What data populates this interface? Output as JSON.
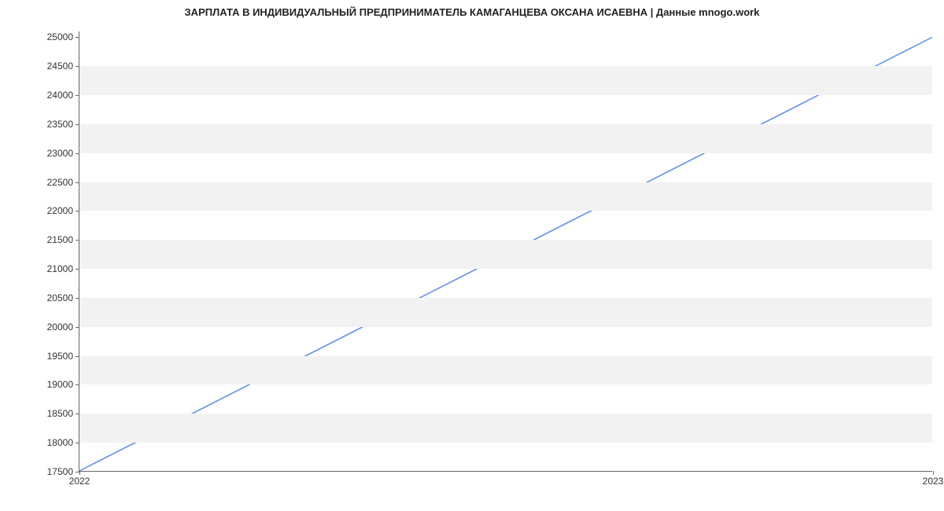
{
  "chart_data": {
    "type": "line",
    "title": "ЗАРПЛАТА В ИНДИВИДУАЛЬНЫЙ ПРЕДПРИНИМАТЕЛЬ КАМАГАНЦЕВА ОКСАНА ИСАЕВНА | Данные mnogo.work",
    "xlabel": "",
    "ylabel": "",
    "x": [
      "2022",
      "2023"
    ],
    "values": [
      17500,
      25000
    ],
    "y_ticks": [
      17500,
      18000,
      18500,
      19000,
      19500,
      20000,
      20500,
      21000,
      21500,
      22000,
      22500,
      23000,
      23500,
      24000,
      24500,
      25000
    ],
    "x_ticks": [
      "2022",
      "2023"
    ],
    "ylim": [
      17500,
      25100
    ],
    "line_color": "#5b8def"
  }
}
